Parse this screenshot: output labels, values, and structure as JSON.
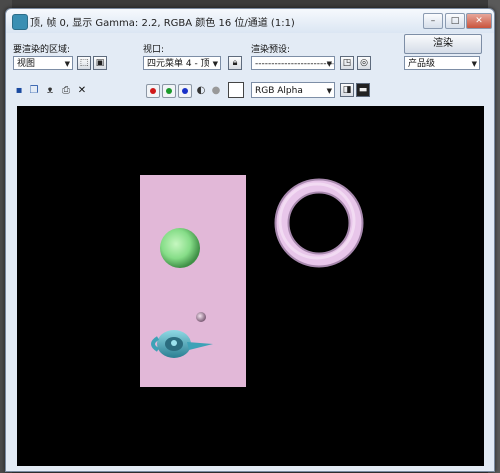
{
  "window": {
    "title": "顶, 帧 0, 显示 Gamma: 2.2, RGBA 颜色 16 位/通道 (1:1)",
    "minimize_glyph": "–",
    "maximize_glyph": "□",
    "close_glyph": "✕"
  },
  "controls": {
    "area_label": "要渲染的区域:",
    "area_value": "视图",
    "viewport_label": "视口:",
    "viewport_value": "四元菜单 4 - 顶",
    "preset_label": "渲染预设:",
    "preset_value": "-------------------------",
    "render_button": "渲染",
    "quality_value": "产品级",
    "channel_value": "RGB Alpha"
  },
  "colors": {
    "red_channel": "#d01818",
    "green_channel": "#1a9a2a",
    "blue_channel": "#1830c8",
    "alpha_channel": "#555555",
    "mono_channel": "#999999"
  },
  "render": {
    "background": "#000000",
    "plane_color": "#e2b8d8",
    "sphere_color": "#8fe08f",
    "torus_color": "#e6c3e8",
    "teapot_color": "#4fb3c8"
  }
}
